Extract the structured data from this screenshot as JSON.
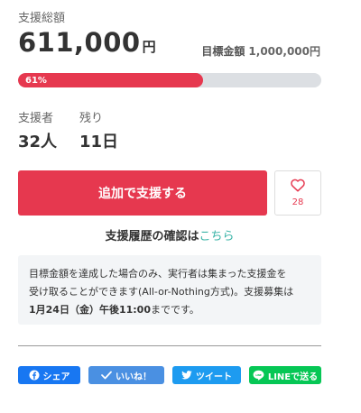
{
  "funding": {
    "total_label": "支援総額",
    "amount": "611,000",
    "unit": "円",
    "goal_label": "目標金額",
    "goal_value": "1,000,000円",
    "progress_text": "61%",
    "progress_fraction": 0.61
  },
  "stats": {
    "supporters_label": "支援者",
    "supporters_value": "32人",
    "remaining_label": "残り",
    "remaining_value": "11日"
  },
  "actions": {
    "support_label": "追加で支援する",
    "favorite_count": "28",
    "favorite_icon": "heart-outline-icon"
  },
  "history": {
    "text": "支援履歴の確認は",
    "link": "こちら"
  },
  "notice": {
    "line1": "目標金額を達成した場合のみ、実行者は集まった支援金を",
    "line2": "受け取ることができます(All-or-Nothing方式)。支援募集は",
    "deadline": "1月24日（金）午後11:00",
    "suffix": "までです。"
  },
  "share": {
    "facebook": "シェア",
    "like": "いいね！",
    "tweet": "ツイート",
    "line": "LINEで送る"
  },
  "colors": {
    "accent": "#e6384f",
    "link": "#37b3a6",
    "facebook": "#1877f2",
    "like": "#4a90e2",
    "twitter": "#1d9bf0",
    "line": "#06c755"
  }
}
